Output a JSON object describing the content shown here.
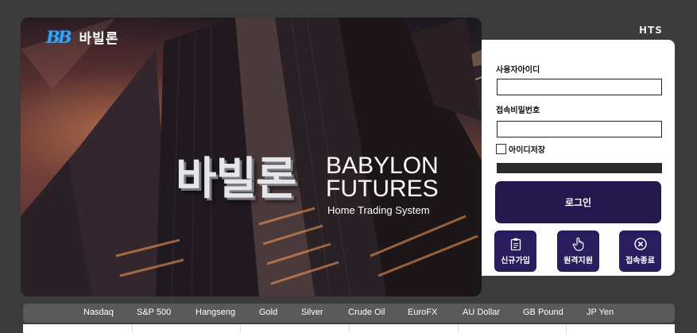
{
  "hero": {
    "logo_mark": "BB",
    "logo_text": "바빌론",
    "brand_ko": "바빌론",
    "brand_en_line1": "BABYLON",
    "brand_en_line2": "FUTURES",
    "brand_sub": "Home Trading System"
  },
  "hts_label": "HTS",
  "login": {
    "user_id_label": "사용자아이디",
    "user_id_value": "",
    "password_label": "접속비밀번호",
    "password_value": "",
    "save_id_label": "아이디저장",
    "save_id_checked": false,
    "progress": 0,
    "login_button": "로그인",
    "actions": [
      {
        "label": "신규가입",
        "icon": "clipboard-icon"
      },
      {
        "label": "원격지원",
        "icon": "hand-pointer-icon"
      },
      {
        "label": "접속종료",
        "icon": "close-circle-icon"
      }
    ]
  },
  "ticker": {
    "items": [
      "Nasdaq",
      "S&P 500",
      "Hangseng",
      "Gold",
      "Silver",
      "Crude Oil",
      "EuroFX",
      "AU Dollar",
      "GB Pound",
      "JP Yen"
    ]
  },
  "colors": {
    "background": "#3b3b3b",
    "accent": "#24184f",
    "logo_blue": "#3aa4f2"
  }
}
